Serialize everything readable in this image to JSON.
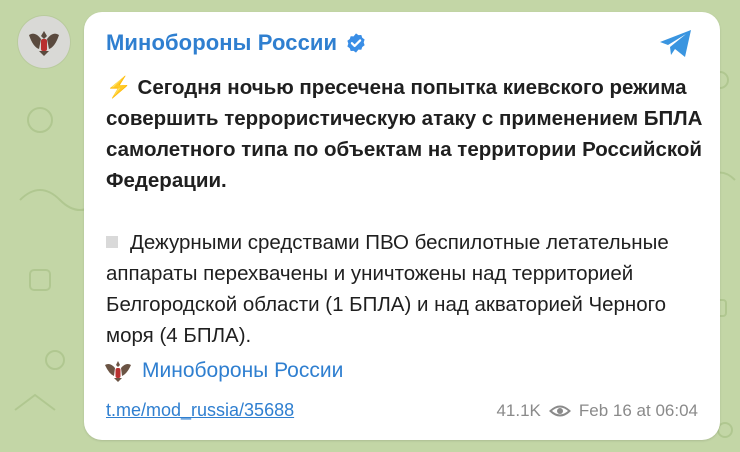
{
  "channel": {
    "name": "Минобороны России",
    "verified": true
  },
  "post": {
    "lead_icon": "lightning-icon",
    "paragraph1": "Сегодня ночью пресечена попытка киевского режима совершить террористическую атаку с применением БПЛА самолетного типа по объектам на территории Российской Федерации.",
    "bullet_icon": "square-bullet-icon",
    "paragraph2": "Дежурными средствами ПВО беспилотные летательные аппараты перехвачены и уничтожены над территорией Белгородской области (1 БПЛА) и над акваторией Черного моря (4 БПЛА).",
    "forward_name": "Минобороны России"
  },
  "footer": {
    "link": "t.me/mod_russia/35688",
    "views": "41.1K",
    "date": "Feb 16 at 06:04"
  },
  "icons": {
    "share": "paper-plane-icon",
    "views": "eye-icon",
    "verified": "verified-badge-icon"
  },
  "colors": {
    "background": "#c3d6a6",
    "accent": "#2f7fd0",
    "lightning": "#f5b900"
  }
}
